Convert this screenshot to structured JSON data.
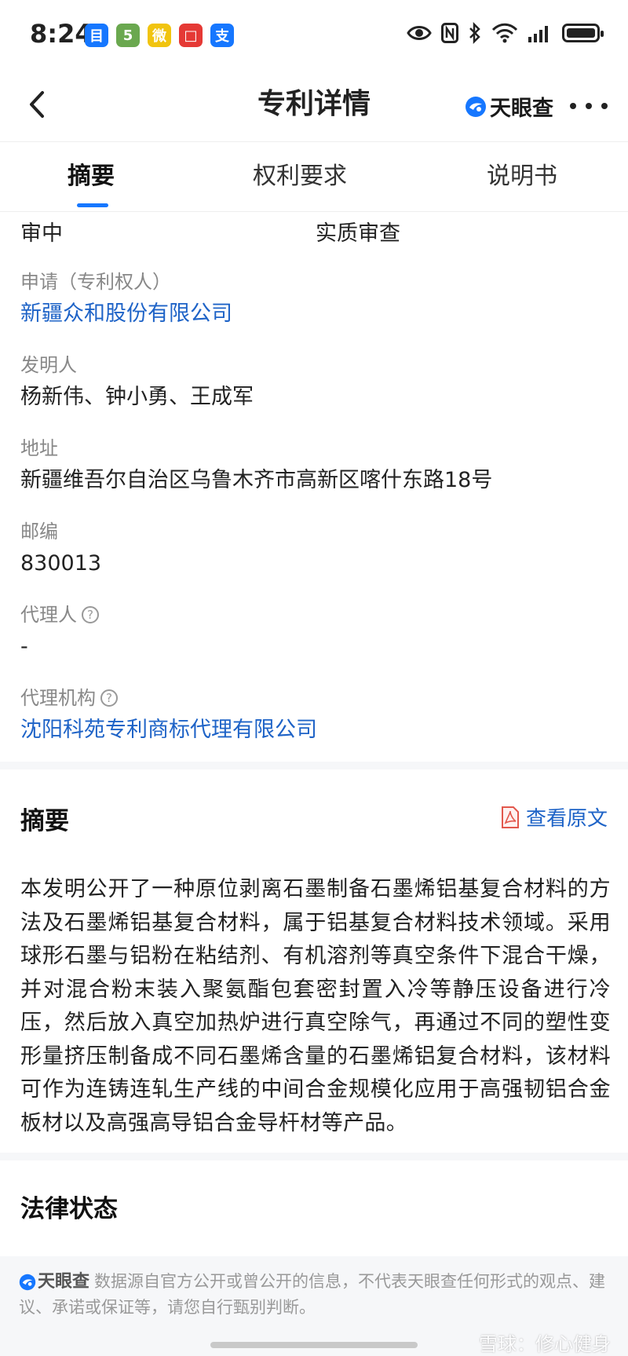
{
  "status": {
    "time": "8:24",
    "apps": [
      {
        "name": "app-icon-1",
        "glyph": "目",
        "color": "#1677ff"
      },
      {
        "name": "app-icon-2",
        "glyph": "5",
        "color": "#6aa84f"
      },
      {
        "name": "weibo-icon",
        "glyph": "微",
        "color": "#f1c40f"
      },
      {
        "name": "app-icon-red",
        "glyph": "□",
        "color": "#e53935"
      },
      {
        "name": "alipay-icon",
        "glyph": "支",
        "color": "#1677ff"
      }
    ]
  },
  "nav": {
    "title": "专利详情",
    "brand": "天眼查"
  },
  "tabs": [
    {
      "label": "摘要",
      "active": true
    },
    {
      "label": "权利要求",
      "active": false
    },
    {
      "label": "说明书",
      "active": false
    }
  ],
  "info": {
    "status_left": "审中",
    "status_right": "实质审查",
    "applicant_label": "申请（专利权人）",
    "applicant_value": "新疆众和股份有限公司",
    "inventor_label": "发明人",
    "inventor_value": "杨新伟、钟小勇、王成军",
    "address_label": "地址",
    "address_value": "新疆维吾尔自治区乌鲁木齐市高新区喀什东路18号",
    "zip_label": "邮编",
    "zip_value": "830013",
    "agent_label": "代理人",
    "agent_value": "-",
    "agency_label": "代理机构",
    "agency_value": "沈阳科苑专利商标代理有限公司"
  },
  "abstract": {
    "title": "摘要",
    "view_original": "查看原文",
    "text": "本发明公开了一种原位剥离石墨制备石墨烯铝基复合材料的方法及石墨烯铝基复合材料，属于铝基复合材料技术领域。采用球形石墨与铝粉在粘结剂、有机溶剂等真空条件下混合干燥，并对混合粉末装入聚氨酯包套密封置入冷等静压设备进行冷压，然后放入真空加热炉进行真空除气，再通过不同的塑性变形量挤压制备成不同石墨烯含量的石墨烯铝复合材料，该材料可作为连铸连轧生产线的中间合金规模化应用于高强韧铝合金板材以及高强高导铝合金导杆材等产品。"
  },
  "legal": {
    "title": "法律状态"
  },
  "footer": {
    "brand": "天眼查",
    "disclaimer": "数据源自官方公开或曾公开的信息，不代表天眼查任何形式的观点、建议、承诺或保证等，请您自行甄别判断。",
    "watermark": "雪球：修心健身"
  }
}
